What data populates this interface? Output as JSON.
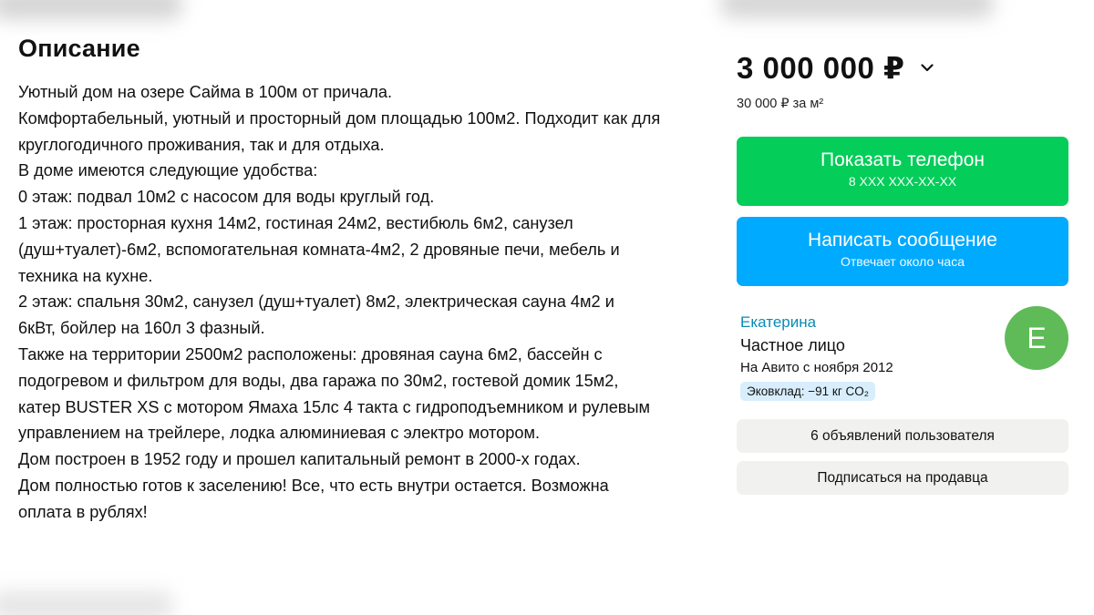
{
  "description": {
    "title": "Описание",
    "lines": [
      "Уютный дом на озере Сайма в 100м от причала.",
      "Комфортабельный, уютный и просторный дом площадью 100м2. Подходит как для",
      "круглогодичного проживания, так и для отдыха.",
      "В доме имеются следующие удобства:",
      "0 этаж: подвал 10м2 с насосом для воды круглый год.",
      "1 этаж: просторная кухня 14м2, гостиная 24м2, вестибюль 6м2, санузел",
      "(душ+туалет)-6м2, вспомогательная комната-4м2, 2 дровяные печи, мебель и",
      "техника на кухне.",
      "2 этаж: спальня 30м2, санузел (душ+туалет) 8м2, электрическая сауна 4м2 и",
      "6кВт, бойлер на 160л 3 фазный.",
      "Также на территории 2500м2 расположены: дровяная сауна 6м2, бассейн с",
      "подогревом и фильтром для воды, два гаража по 30м2, гостевой домик 15м2,",
      "катер BUSTER XS с мотором Ямаха 15лс 4 такта с гидроподъемником и рулевым",
      "управлением на трейлере, лодка алюминиевая с электро мотором.",
      "Дом построен в 1952 году и прошел капитальный ремонт в 2000-х годах.",
      "Дом полностью готов к заселению! Все, что есть внутри остается. Возможна",
      "оплата в рублях!"
    ]
  },
  "pricing": {
    "price": "3 000 000 ₽",
    "price_per_m2": "30 000 ₽ за м²",
    "chevron_icon": "chevron-down-icon"
  },
  "actions": {
    "phone_label": "Показать телефон",
    "phone_number": "8 XXX XXX-XX-XX",
    "message_label": "Написать сообщение",
    "message_sub": "Отвечает около часа"
  },
  "seller": {
    "name": "Екатерина",
    "type": "Частное лицо",
    "since": "На Авито с ноября 2012",
    "eco_badge": "Эковклад: −91 кг CO₂",
    "avatar_letter": "Е",
    "ads_button": "6 объявлений пользователя",
    "subscribe_button": "Подписаться на продавца"
  },
  "colors": {
    "phone_button": "#04cd5a",
    "message_button": "#00aaff",
    "seller_name": "#0a8bb5",
    "avatar": "#5fbb58",
    "eco_badge_bg": "#d8eefc",
    "gray_button_bg": "#f1f1f0"
  }
}
